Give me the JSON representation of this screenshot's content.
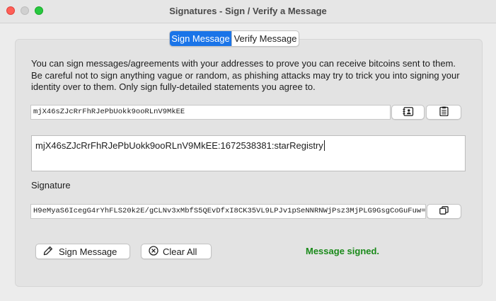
{
  "window": {
    "title": "Signatures - Sign / Verify a Message"
  },
  "tabs": [
    {
      "label": "Sign Message",
      "active": true
    },
    {
      "label": "Verify Message",
      "active": false
    }
  ],
  "sign": {
    "info_text": "You can sign messages/agreements with your addresses to prove you can receive bitcoins sent to them. Be careful not to sign anything vague or random, as phishing attacks may try to trick you into signing your identity over to them. Only sign fully-detailed statements you agree to.",
    "address_value": "mjX46sZJcRrFhRJePbUokk9ooRLnV9MkEE",
    "address_book_icon": "address-book-icon",
    "paste_icon": "paste-icon",
    "message_value": "mjX46sZJcRrFhRJePbUokk9ooRLnV9MkEE:1672538381:starRegistry",
    "signature_label": "Signature",
    "signature_value": "H9eMyaS6IcegG4rYhFLS20k2E/gCLNv3xMbfS5QEvDfxI8CK35VL9LPJv1pSeNNRNWjPsz3MjPLG9GsgCoGuFuw=",
    "copy_icon": "copy-icon",
    "sign_button_label": "Sign Message",
    "sign_button_icon": "pen-icon",
    "clear_button_label": "Clear All",
    "clear_button_icon": "clear-circle-x-icon",
    "status_text": "Message signed.",
    "status_color": "#1a8a1a"
  },
  "colors": {
    "accent": "#1a74e8",
    "close": "#ff5f57",
    "minimize": "#d0d0d0",
    "maximize": "#28c840"
  }
}
